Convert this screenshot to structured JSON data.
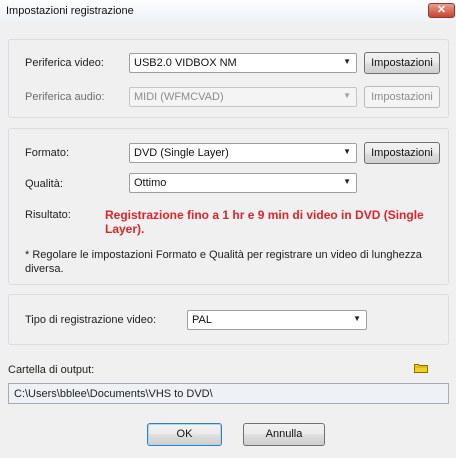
{
  "window": {
    "title": "Impostazioni registrazione",
    "close_glyph": "✕"
  },
  "devices": {
    "video_label": "Periferica video:",
    "video_value": "USB2.0 VIDBOX NM",
    "video_settings": "Impostazioni",
    "audio_label": "Periferica audio:",
    "audio_value": "MIDI (WFMCVAD)",
    "audio_settings": "Impostazioni"
  },
  "format": {
    "format_label": "Formato:",
    "format_value": "DVD (Single Layer)",
    "format_settings": "Impostazioni",
    "quality_label": "Qualità:",
    "quality_value": "Ottimo",
    "result_label": "Risultato:",
    "result_text": "Registrazione fino a 1 hr e 9 min di video in DVD (Single Layer).",
    "note_text": "*  Regolare le impostazioni Formato e Qualità per registrare un video di lunghezza diversa."
  },
  "recording": {
    "type_label": "Tipo di registrazione video:",
    "type_value": "PAL"
  },
  "output": {
    "folder_label": "Cartella di output:",
    "folder_icon": "folder-icon",
    "path": "C:\\Users\\bblee\\Documents\\VHS to DVD\\"
  },
  "buttons": {
    "ok": "OK",
    "cancel": "Annulla"
  },
  "colors": {
    "result_text": "#d9252b",
    "close_button": "#c7442c",
    "folder_icon": "#f3d21b"
  }
}
